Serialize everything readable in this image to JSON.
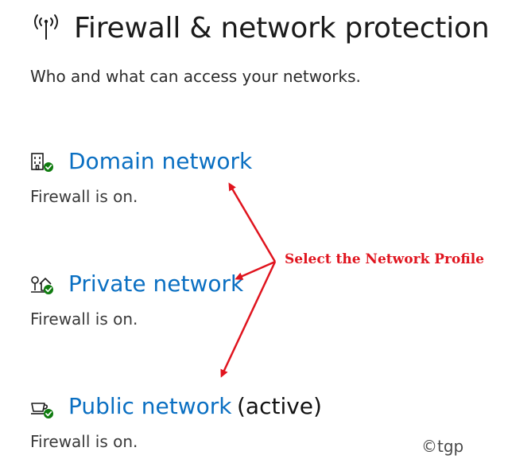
{
  "header": {
    "title": "Firewall & network protection",
    "subtitle": "Who and what can access your networks.",
    "icon": "antenna-icon"
  },
  "networks": [
    {
      "label": "Domain network",
      "status": "Firewall is on.",
      "icon": "domain-building-icon",
      "active_label": ""
    },
    {
      "label": "Private network",
      "status": "Firewall is on.",
      "icon": "private-home-icon",
      "active_label": ""
    },
    {
      "label": "Public network",
      "status": "Firewall is on.",
      "icon": "public-coffee-icon",
      "active_label": "(active)"
    }
  ],
  "annotation": {
    "text": "Select the Network Profile",
    "color": "#e0141e"
  },
  "watermark": "©tgp",
  "colors": {
    "link": "#0a6fc2",
    "status_check": "#107c10",
    "text": "#1b1b1b"
  }
}
